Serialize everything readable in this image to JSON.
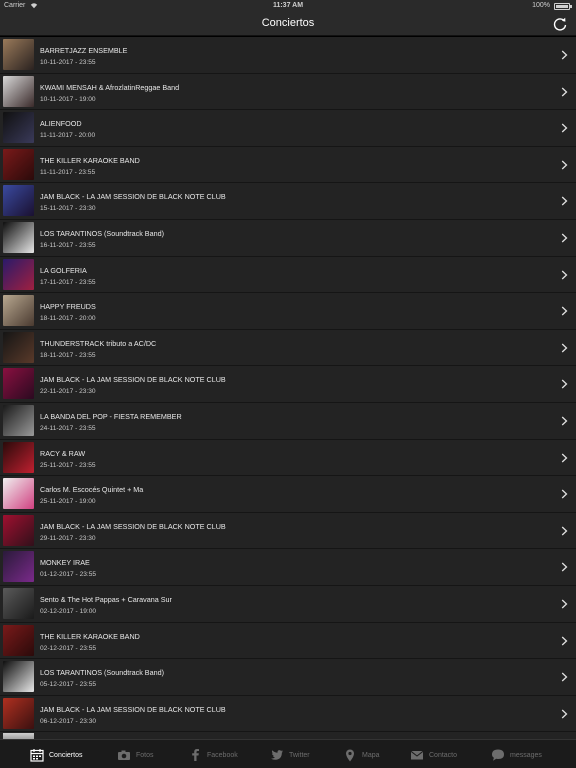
{
  "status_bar": {
    "carrier": "Carrier",
    "time": "11:37 AM",
    "battery": "100%"
  },
  "nav": {
    "title": "Conciertos"
  },
  "events": [
    {
      "name": "BARRETJAZZ ENSEMBLE",
      "date": "10-11-2017 - 23:55",
      "thumb": [
        "#9a7a5a",
        "#2a2220"
      ]
    },
    {
      "name": "KWAMI MENSAH & AfrozlatinReggae Band",
      "date": "10-11-2017 - 19:00",
      "thumb": [
        "#d8d8d8",
        "#3a2a2a"
      ]
    },
    {
      "name": "ALIENFOOD",
      "date": "11-11-2017 - 20:00",
      "thumb": [
        "#101010",
        "#3a3a5a"
      ]
    },
    {
      "name": "THE KILLER KARAOKE BAND",
      "date": "11-11-2017 - 23:55",
      "thumb": [
        "#7a1a1a",
        "#2a0a0a"
      ]
    },
    {
      "name": "JAM BLACK - LA JAM SESSION DE BLACK NOTE CLUB",
      "date": "15-11-2017 - 23:30",
      "thumb": [
        "#3a4aa0",
        "#1a1030"
      ]
    },
    {
      "name": "LOS TARANTINOS (Soundtrack Band)",
      "date": "16-11-2017 - 23:55",
      "thumb": [
        "#0e0e0e",
        "#e8e8e8"
      ]
    },
    {
      "name": "LA GOLFERIA",
      "date": "17-11-2017 - 23:55",
      "thumb": [
        "#2a1a6a",
        "#a02040"
      ]
    },
    {
      "name": "HAPPY FREUDS",
      "date": "18-11-2017 - 20:00",
      "thumb": [
        "#b8a890",
        "#4a3a30"
      ]
    },
    {
      "name": "THUNDERSTRACK tributo a AC/DC",
      "date": "18-11-2017 - 23:55",
      "thumb": [
        "#151515",
        "#5a3a2a"
      ]
    },
    {
      "name": "JAM BLACK - LA JAM SESSION DE BLACK NOTE CLUB",
      "date": "22-11-2017 - 23:30",
      "thumb": [
        "#8a1040",
        "#2a0a20"
      ]
    },
    {
      "name": "LA BANDA DEL POP - FIESTA REMEMBER",
      "date": "24-11-2017 - 23:55",
      "thumb": [
        "#1a1a1a",
        "#9a9a9a"
      ]
    },
    {
      "name": "RACY & RAW",
      "date": "25-11-2017 - 23:55",
      "thumb": [
        "#2a0a0a",
        "#c02030"
      ]
    },
    {
      "name": "Carlos M. Escocés Quintet + Ma",
      "date": "25-11-2017 - 19:00",
      "thumb": [
        "#f0f0f0",
        "#d04080"
      ]
    },
    {
      "name": "JAM BLACK - LA JAM SESSION DE BLACK NOTE CLUB",
      "date": "29-11-2017 - 23:30",
      "thumb": [
        "#a01030",
        "#30101a"
      ]
    },
    {
      "name": "MONKEY IRAE",
      "date": "01-12-2017 - 23:55",
      "thumb": [
        "#2a1a3a",
        "#7a2a8a"
      ]
    },
    {
      "name": "Sento & The Hot Pappas + Caravana Sur",
      "date": "02-12-2017 - 19:00",
      "thumb": [
        "#5a5a5a",
        "#1a1a1a"
      ]
    },
    {
      "name": "THE KILLER KARAOKE BAND",
      "date": "02-12-2017 - 23:55",
      "thumb": [
        "#7a1a1a",
        "#2a0a0a"
      ]
    },
    {
      "name": "LOS TARANTINOS (Soundtrack Band)",
      "date": "05-12-2017 - 23:55",
      "thumb": [
        "#0e0e0e",
        "#e8e8e8"
      ]
    },
    {
      "name": "JAM BLACK - LA JAM SESSION DE BLACK NOTE CLUB",
      "date": "06-12-2017 - 23:30",
      "thumb": [
        "#b03020",
        "#3a1010"
      ]
    }
  ],
  "tabs": [
    {
      "label": "Conciertos",
      "icon": "calendar-icon",
      "active": true
    },
    {
      "label": "Fotos",
      "icon": "camera-icon",
      "active": false
    },
    {
      "label": "Facebook",
      "icon": "facebook-icon",
      "active": false
    },
    {
      "label": "Twitter",
      "icon": "twitter-icon",
      "active": false
    },
    {
      "label": "Mapa",
      "icon": "map-pin-icon",
      "active": false
    },
    {
      "label": "Contacto",
      "icon": "mail-icon",
      "active": false
    },
    {
      "label": "messages",
      "icon": "chat-bubble-icon",
      "active": false
    }
  ],
  "colors": {
    "background": "#232323",
    "bar": "#2a2a2a",
    "tab_active": "#ffffff",
    "tab_inactive": "#6d6d6d"
  }
}
